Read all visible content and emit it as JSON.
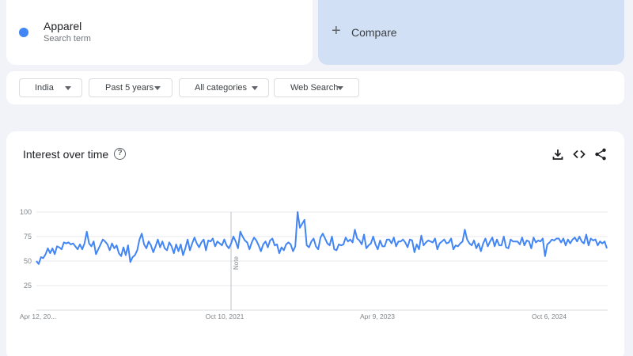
{
  "term": {
    "name": "Apparel",
    "subtitle": "Search term",
    "color": "#4285f4"
  },
  "compare": {
    "plus": "+",
    "label": "Compare"
  },
  "filters": [
    {
      "label": "India"
    },
    {
      "label": "Past 5 years"
    },
    {
      "label": "All categories"
    },
    {
      "label": "Web Search"
    }
  ],
  "chart": {
    "title": "Interest over time",
    "icons": [
      "help-icon",
      "download-icon",
      "embed-icon",
      "share-icon"
    ],
    "note_label": "Note"
  },
  "chart_data": {
    "type": "line",
    "yticks": [
      100,
      75,
      50,
      25
    ],
    "ylim": [
      0,
      100
    ],
    "xtick_labels": [
      "Apr 12, 20...",
      "Oct 10, 2021",
      "Apr 9, 2023",
      "Oct 6, 2024"
    ],
    "series": [
      {
        "color": "#4285f4",
        "values": [
          50,
          47,
          54,
          53,
          57,
          63,
          58,
          63,
          57,
          65,
          64,
          62,
          69,
          68,
          69,
          67,
          68,
          65,
          62,
          67,
          62,
          68,
          80,
          68,
          65,
          70,
          57,
          62,
          67,
          72,
          70,
          67,
          61,
          68,
          63,
          66,
          58,
          55,
          64,
          56,
          66,
          49,
          54,
          56,
          61,
          72,
          78,
          67,
          63,
          70,
          66,
          59,
          65,
          72,
          64,
          70,
          63,
          61,
          69,
          65,
          58,
          67,
          60,
          67,
          56,
          63,
          72,
          61,
          68,
          74,
          68,
          64,
          69,
          72,
          61,
          71,
          70,
          73,
          65,
          70,
          68,
          66,
          72,
          66,
          63,
          68,
          75,
          70,
          63,
          80,
          75,
          71,
          69,
          62,
          69,
          74,
          71,
          66,
          60,
          67,
          70,
          64,
          71,
          73,
          66,
          67,
          58,
          64,
          61,
          67,
          69,
          67,
          60,
          65,
          100,
          84,
          88,
          92,
          66,
          64,
          70,
          73,
          65,
          62,
          74,
          78,
          73,
          68,
          66,
          75,
          62,
          61,
          67,
          66,
          67,
          74,
          70,
          72,
          69,
          82,
          73,
          71,
          67,
          77,
          63,
          66,
          68,
          75,
          67,
          62,
          71,
          65,
          65,
          72,
          72,
          68,
          74,
          65,
          70,
          70,
          72,
          69,
          64,
          72,
          71,
          59,
          67,
          62,
          76,
          66,
          69,
          71,
          70,
          69,
          73,
          62,
          68,
          70,
          72,
          68,
          69,
          73,
          62,
          66,
          65,
          68,
          70,
          82,
          72,
          68,
          66,
          71,
          63,
          68,
          60,
          68,
          73,
          65,
          70,
          74,
          65,
          72,
          66,
          66,
          75,
          64,
          63,
          72,
          70,
          70,
          70,
          67,
          74,
          66,
          71,
          70,
          63,
          74,
          69,
          71,
          70,
          73,
          55,
          67,
          69,
          72,
          71,
          73,
          73,
          69,
          73,
          66,
          72,
          68,
          72,
          74,
          70,
          75,
          70,
          68,
          77,
          66,
          73,
          71,
          72,
          66,
          70,
          68,
          70,
          63
        ]
      }
    ]
  }
}
